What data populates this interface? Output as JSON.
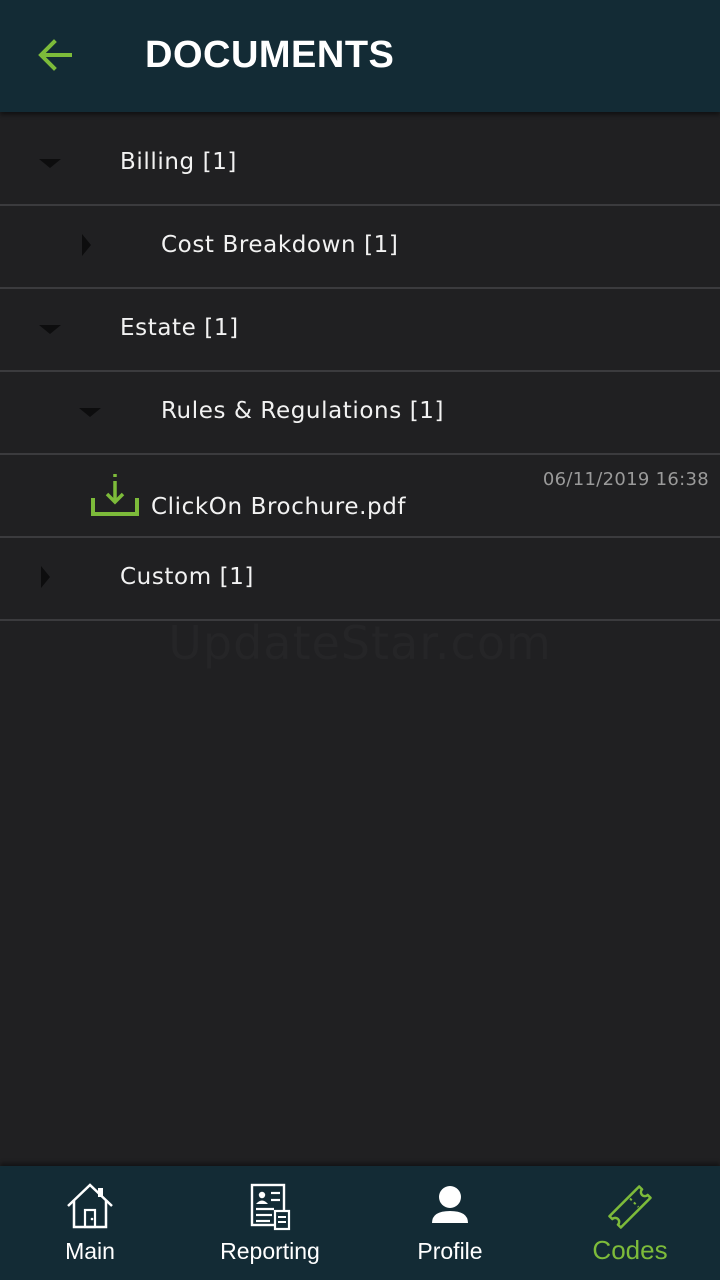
{
  "header": {
    "title": "DOCUMENTS",
    "back_icon": "arrow-left-icon",
    "accent_color": "#7dbb3a"
  },
  "tree": {
    "billing": {
      "label": "Billing [1]",
      "state": "expanded"
    },
    "cost_breakdown": {
      "label": "Cost Breakdown [1]",
      "state": "collapsed"
    },
    "estate": {
      "label": "Estate [1]",
      "state": "expanded"
    },
    "rules_regulations": {
      "label": "Rules & Regulations [1]",
      "state": "expanded"
    },
    "file": {
      "name": "ClickOn Brochure.pdf",
      "date": "06/11/2019 16:38",
      "icon": "download-icon"
    },
    "custom": {
      "label": "Custom [1]",
      "state": "collapsed"
    }
  },
  "watermark": "UpdateStar.com",
  "bottom_nav": {
    "active": "codes",
    "main": {
      "label": "Main",
      "icon": "home-icon"
    },
    "reporting": {
      "label": "Reporting",
      "icon": "report-icon"
    },
    "profile": {
      "label": "Profile",
      "icon": "person-icon"
    },
    "codes": {
      "label": "Codes",
      "icon": "ticket-icon"
    }
  }
}
